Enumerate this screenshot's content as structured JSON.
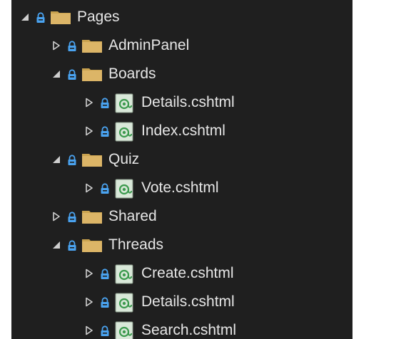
{
  "explorer": {
    "nodes": [
      {
        "label": "Pages",
        "kind": "folder",
        "expand": "expanded"
      },
      {
        "label": "AdminPanel",
        "kind": "folder",
        "expand": "collapsed"
      },
      {
        "label": "Boards",
        "kind": "folder",
        "expand": "expanded"
      },
      {
        "label": "Details.cshtml",
        "kind": "razor-file",
        "expand": "collapsed"
      },
      {
        "label": "Index.cshtml",
        "kind": "razor-file",
        "expand": "collapsed"
      },
      {
        "label": "Quiz",
        "kind": "folder",
        "expand": "expanded"
      },
      {
        "label": "Vote.cshtml",
        "kind": "razor-file",
        "expand": "collapsed"
      },
      {
        "label": "Shared",
        "kind": "folder",
        "expand": "collapsed"
      },
      {
        "label": "Threads",
        "kind": "folder",
        "expand": "expanded"
      },
      {
        "label": "Create.cshtml",
        "kind": "razor-file",
        "expand": "collapsed"
      },
      {
        "label": "Details.cshtml",
        "kind": "razor-file",
        "expand": "collapsed"
      },
      {
        "label": "Search.cshtml",
        "kind": "razor-file",
        "expand": "collapsed"
      }
    ]
  },
  "colors": {
    "background": "#1f1f1f",
    "text": "#e6e6e6",
    "lock": "#4aa3f0",
    "folder": "#dcb567",
    "folder_tab": "#c9a24f",
    "razor_green": "#3c9a4e",
    "razor_bg": "#d9e8d9",
    "expander": "#cfcfcf"
  },
  "icons": {
    "expanded": "triangle-expanded-icon",
    "collapsed": "triangle-collapsed-icon",
    "lock": "lock-icon",
    "folder": "folder-icon",
    "razor-file": "razor-file-icon"
  }
}
